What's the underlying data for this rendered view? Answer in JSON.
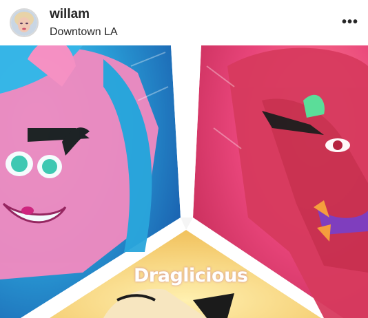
{
  "post_header": {
    "username": "willam",
    "location": "Downtown LA",
    "more_label": "•••"
  },
  "media": {
    "watermark_text": "Draglicious",
    "panels": [
      "blue-haired character",
      "red character",
      "yellow character"
    ]
  },
  "colors": {
    "text": "#262626",
    "blue_panel": "#2a9fd8",
    "pink_panel": "#e8457a",
    "yellow_panel": "#f7d27a",
    "divider": "#ffffff"
  }
}
